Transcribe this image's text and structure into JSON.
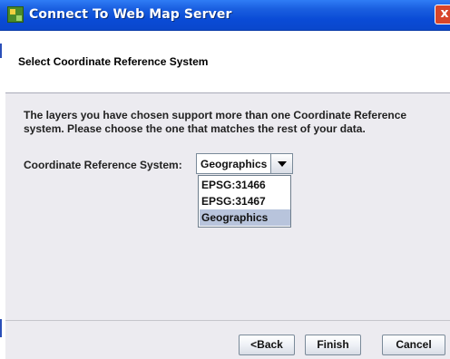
{
  "window": {
    "title": "Connect To Web Map Server",
    "close_label": "x"
  },
  "header": {
    "title": "Select Coordinate Reference System"
  },
  "content": {
    "description_line1": "The layers you have chosen support more than one Coordinate Reference",
    "description_line2": "system. Please choose the one that matches the rest of your data.",
    "crs_label": "Coordinate Reference System:"
  },
  "crs_combo": {
    "selected": "Geographics",
    "options": [
      "EPSG:31466",
      "EPSG:31467",
      "Geographics"
    ]
  },
  "buttons": {
    "back": "<Back",
    "finish": "Finish",
    "cancel": "Cancel"
  },
  "colors": {
    "titlebar": "#0a4bd6",
    "selection": "#b8c4dc",
    "panel": "#ecebf0"
  }
}
